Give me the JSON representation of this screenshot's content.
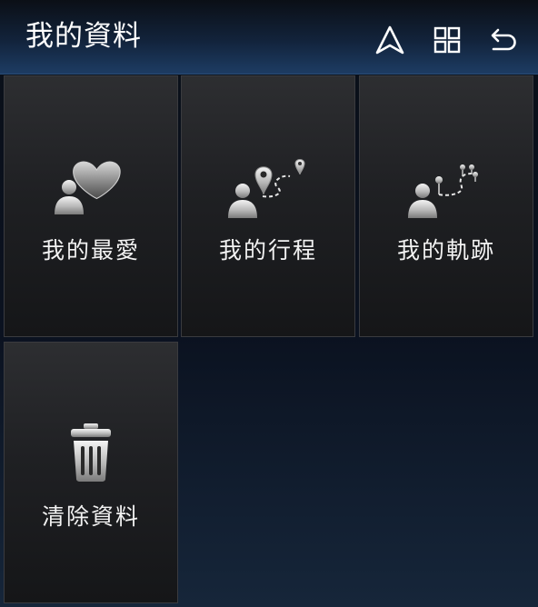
{
  "header": {
    "title": "我的資料",
    "icons": [
      "navigation-icon",
      "grid-icon",
      "back-icon"
    ]
  },
  "tiles": [
    {
      "label": "我的最愛",
      "icon": "user-heart-icon"
    },
    {
      "label": "我的行程",
      "icon": "user-route-icon"
    },
    {
      "label": "我的軌跡",
      "icon": "user-track-icon"
    },
    {
      "label": "清除資料",
      "icon": "trash-icon"
    }
  ],
  "colors": {
    "header_top": "#0b0f16",
    "header_bottom": "#1d3c63",
    "tile_top": "#2d2e31",
    "tile_bottom": "#151618",
    "text": "#ffffff"
  }
}
